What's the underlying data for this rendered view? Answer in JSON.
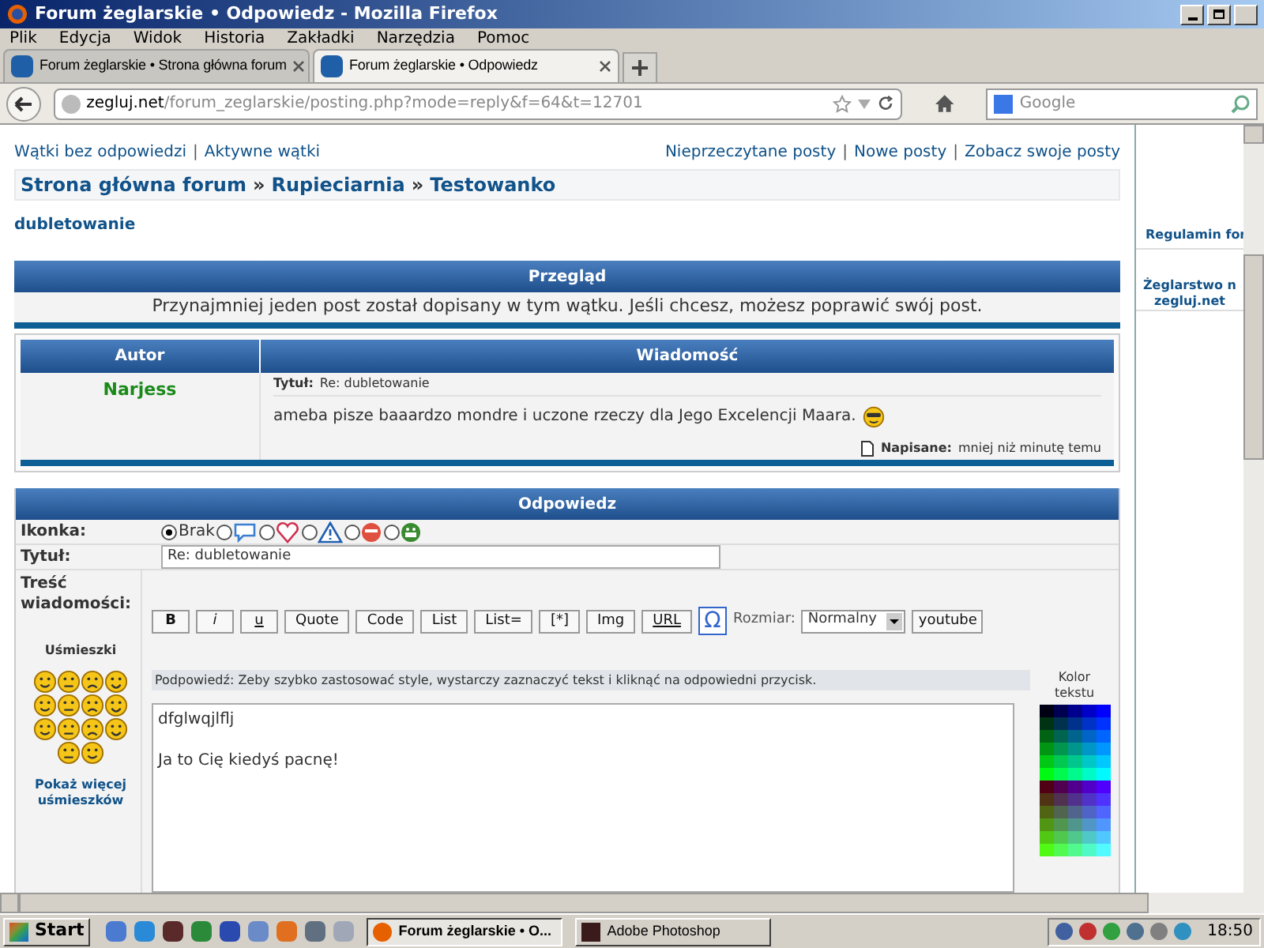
{
  "window": {
    "title": "Forum żeglarskie • Odpowiedz - Mozilla Firefox"
  },
  "menu": [
    "Plik",
    "Edycja",
    "Widok",
    "Historia",
    "Zakładki",
    "Narzędzia",
    "Pomoc"
  ],
  "tabs": [
    {
      "label": "Forum żeglarskie • Strona główna forum",
      "selected": false
    },
    {
      "label": "Forum żeglarskie • Odpowiedz",
      "selected": true
    }
  ],
  "address": {
    "domain": "zegluj.net",
    "path": "/forum_zeglarskie/posting.php?mode=reply&f=64&t=12701"
  },
  "search": {
    "placeholder": "Google"
  },
  "top_links_left": [
    "Wątki bez odpowiedzi",
    "Aktywne wątki"
  ],
  "top_links_right": [
    "Nieprzeczytane posty",
    "Nowe posty",
    "Zobacz swoje posty"
  ],
  "breadcrumb": [
    "Strona główna forum",
    "Rupieciarnia",
    "Testowanko"
  ],
  "breadcrumb_separator": "»",
  "link_separator": "|",
  "topic_title": "dubletowanie",
  "review": {
    "heading": "Przegląd",
    "notice": "Przynajmniej jeden post został dopisany w tym wątku. Jeśli chcesz, możesz poprawić swój post.",
    "columns": [
      "Autor",
      "Wiadomość"
    ],
    "post": {
      "author": "Narjess",
      "subject_label": "Tytuł:",
      "subject": "Re: dubletowanie",
      "body": "ameba pisze baaardzo mondre i uczone rzeczy dla Jego Excelencji Maara.",
      "posted_label": "Napisane:",
      "posted": "mniej niż minutę temu"
    }
  },
  "reply": {
    "heading": "Odpowiedz",
    "icon_label": "Ikonka:",
    "icons": [
      {
        "label": "Brak",
        "selected": true
      },
      {
        "selected": false
      },
      {
        "selected": false
      },
      {
        "selected": false
      },
      {
        "selected": false
      },
      {
        "selected": false
      }
    ],
    "subject_label": "Tytuł:",
    "subject": "Re: dubletowanie",
    "message_label": "Treść wiadomości:",
    "smilies_label": "Uśmieszki",
    "more_smilies": "Pokaż więcej uśmieszków",
    "buttons": [
      "B",
      "i",
      "u",
      "Quote",
      "Code",
      "List",
      "List=",
      "[*]",
      "Img",
      "URL"
    ],
    "omega": "Ω",
    "size_label": "Rozmiar:",
    "size": "Normalny",
    "youtube": "youtube",
    "hint": "Podpowiedź: Zeby szybko zastosować style, wystarczy zaznaczyć tekst i kliknąć na odpowiedni przycisk.",
    "color_label": "Kolor tekstu",
    "message_lines": [
      "dfglwqjlflj",
      "Ja to Cię kiedyś pacnę!"
    ]
  },
  "sidebar": [
    "Regulamin for",
    "Żeglarstwo n zegluj.net"
  ],
  "taskbar": {
    "start": "Start",
    "tasks": [
      {
        "label": "Forum żeglarskie • O...",
        "selected": true
      },
      {
        "label": "Adobe Photoshop",
        "selected": false
      }
    ],
    "clock": "18:50"
  }
}
